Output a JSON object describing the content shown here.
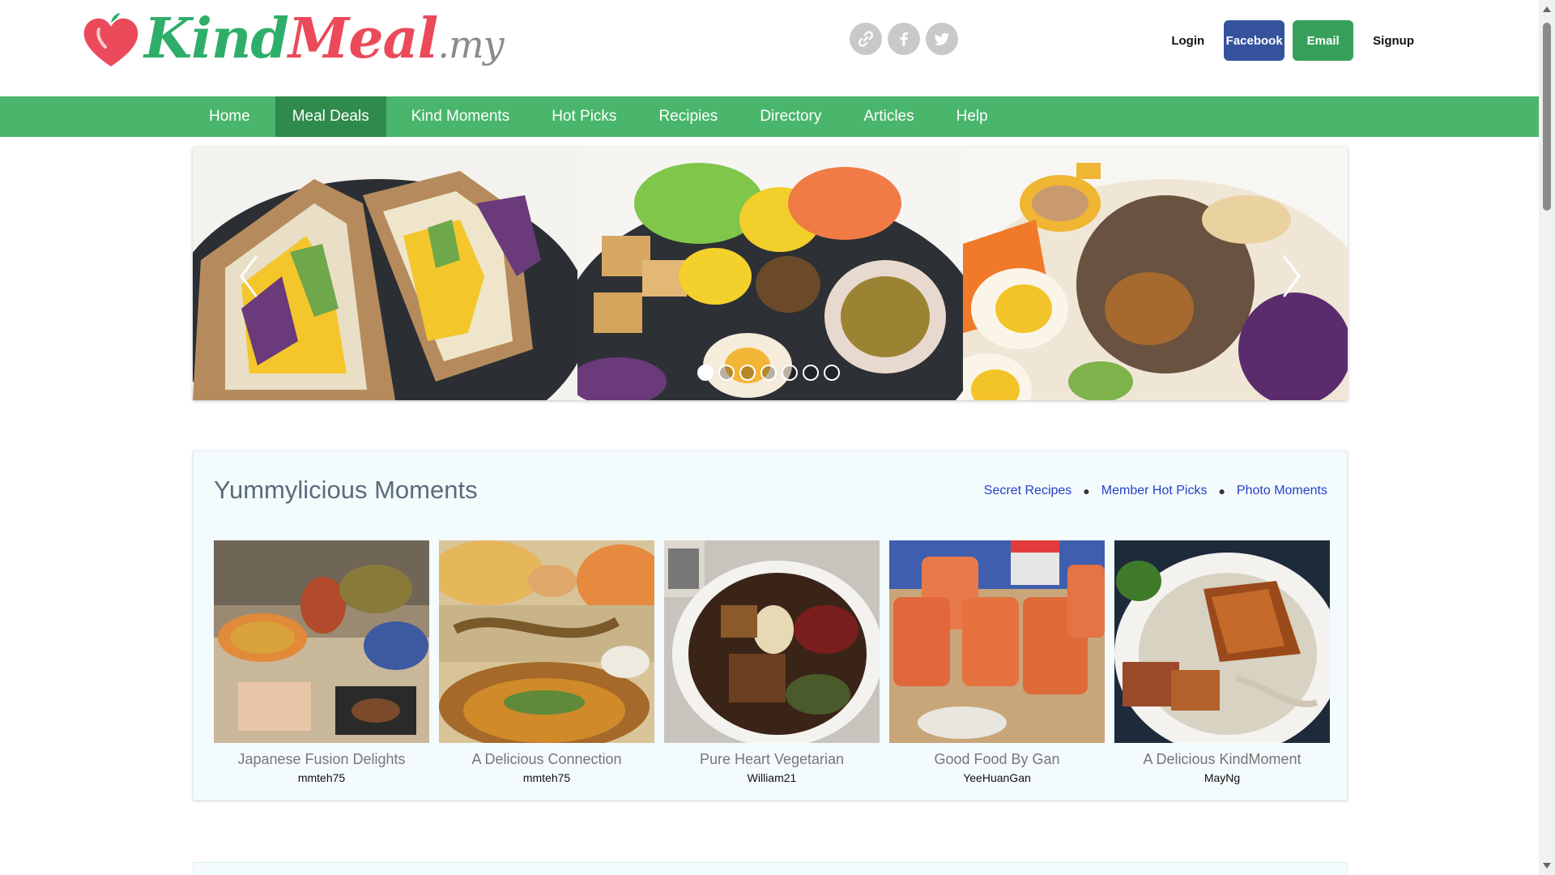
{
  "header": {
    "logo": {
      "kind": "Kind",
      "meal": "Meal",
      "tld": ".my",
      "icon": "heart-apple-icon"
    },
    "social": [
      {
        "name": "link-icon"
      },
      {
        "name": "facebook-icon"
      },
      {
        "name": "twitter-icon"
      }
    ],
    "auth": {
      "login": "Login",
      "facebook": "Facebook",
      "email": "Email",
      "signup": "Signup"
    }
  },
  "nav": {
    "items": [
      "Home",
      "Meal Deals",
      "Kind Moments",
      "Hot Picks",
      "Recipies",
      "Directory",
      "Articles",
      "Help"
    ],
    "active_index": 1
  },
  "slider": {
    "dot_count": 7,
    "active_dot": 0
  },
  "moments": {
    "title": "Yummylicious Moments",
    "links": [
      "Secret Recipes",
      "Member Hot Picks",
      "Photo Moments"
    ],
    "cards": [
      {
        "title": "Japanese Fusion Delights",
        "user": "mmteh75"
      },
      {
        "title": "A Delicious Connection",
        "user": "mmteh75"
      },
      {
        "title": "Pure Heart Vegetarian",
        "user": "William21"
      },
      {
        "title": "Good Food By Gan",
        "user": "YeeHuanGan"
      },
      {
        "title": "A Delicious KindMoment",
        "user": "MayNg"
      }
    ]
  },
  "colors": {
    "nav": "#49b66b",
    "nav_active": "#2f8a4d",
    "facebook": "#35539d",
    "email": "#36a05a",
    "link": "#2740c8"
  }
}
